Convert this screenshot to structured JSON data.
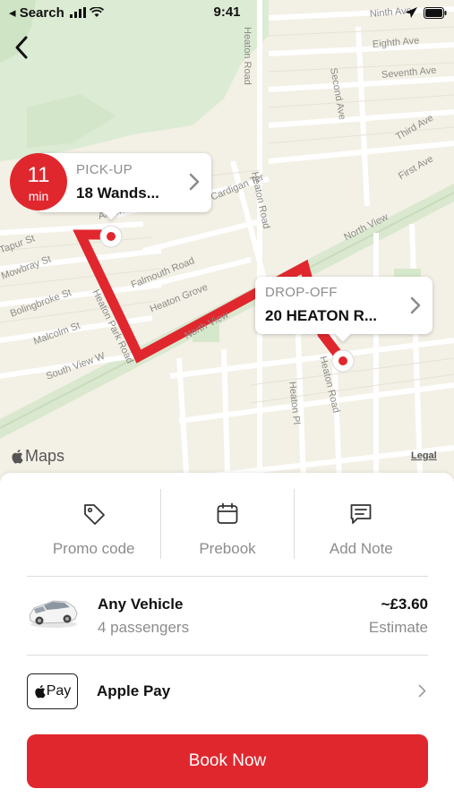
{
  "status_bar": {
    "back_app": "◂ Search",
    "time": "9:41"
  },
  "map": {
    "streets": [
      "Heaton Road",
      "Ninth Ave",
      "Eighth Ave",
      "Second Ave",
      "Seventh Ave",
      "Third Ave",
      "First Ave",
      "North View",
      "Heaton Road",
      "Cardigan Ter",
      "Falmouth Road",
      "Heaton Grove",
      "North View",
      "Heaton Park Road",
      "Jesmond Vale",
      "Tapur St",
      "Mowbray St",
      "Bolingbroke St",
      "Malcolm St",
      "South View W",
      "Heaton Pl",
      "Heaton Road",
      "Ardsward"
    ],
    "eta": {
      "value": "11",
      "unit": "min"
    },
    "pickup": {
      "label": "PICK-UP",
      "value": "18 Wands..."
    },
    "dropoff": {
      "label": "DROP-OFF",
      "value": "20 HEATON R..."
    },
    "maps_brand": "Maps",
    "legal": "Legal",
    "route_color": "#e0272e"
  },
  "actions": [
    {
      "label": "Promo code",
      "icon": "tag-icon"
    },
    {
      "label": "Prebook",
      "icon": "calendar-icon"
    },
    {
      "label": "Add Note",
      "icon": "note-icon"
    }
  ],
  "vehicle": {
    "name": "Any Vehicle",
    "passengers": "4 passengers",
    "price": "~£3.60",
    "price_note": "Estimate"
  },
  "payment": {
    "badge_text": "Pay",
    "method": "Apple Pay"
  },
  "book_button": "Book Now",
  "accent_color": "#e0272e"
}
